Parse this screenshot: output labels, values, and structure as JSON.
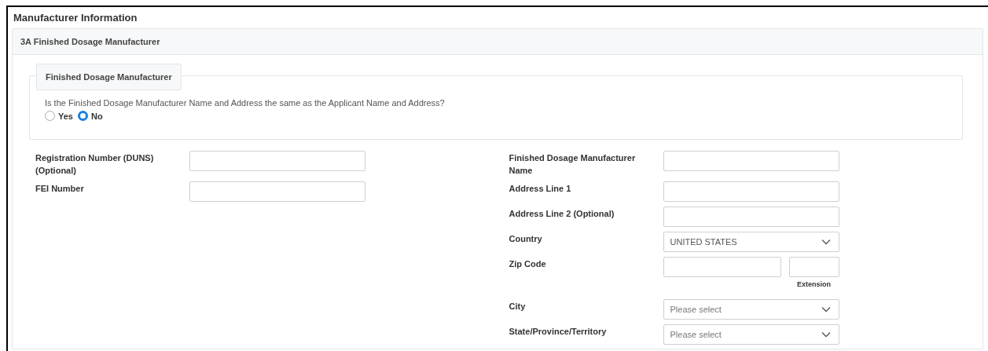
{
  "title": "Manufacturer Information",
  "section": {
    "header": "3A Finished Dosage Manufacturer"
  },
  "fieldset": {
    "legend": "Finished Dosage Manufacturer",
    "question": "Is the Finished Dosage Manufacturer Name and Address the same as the Applicant Name and Address?",
    "options": [
      {
        "label": "Yes",
        "selected": false
      },
      {
        "label": "No",
        "selected": true
      }
    ]
  },
  "left_fields": [
    {
      "kind": "text",
      "label": "Registration Number (DUNS) (Optional)"
    },
    {
      "kind": "text",
      "label": "FEI Number"
    }
  ],
  "right_fields": [
    {
      "kind": "text",
      "label": "Finished Dosage Manufacturer Name"
    },
    {
      "kind": "text",
      "label": "Address Line 1"
    },
    {
      "kind": "text",
      "label": "Address Line 2 (Optional)"
    },
    {
      "kind": "select",
      "label": "Country",
      "value": "UNITED STATES"
    },
    {
      "kind": "zip",
      "label": "Zip Code",
      "caption": "Extension"
    },
    {
      "kind": "select",
      "label": "City",
      "placeholder": "Please select"
    },
    {
      "kind": "select",
      "label": "State/Province/Territory",
      "placeholder": "Please select"
    }
  ]
}
